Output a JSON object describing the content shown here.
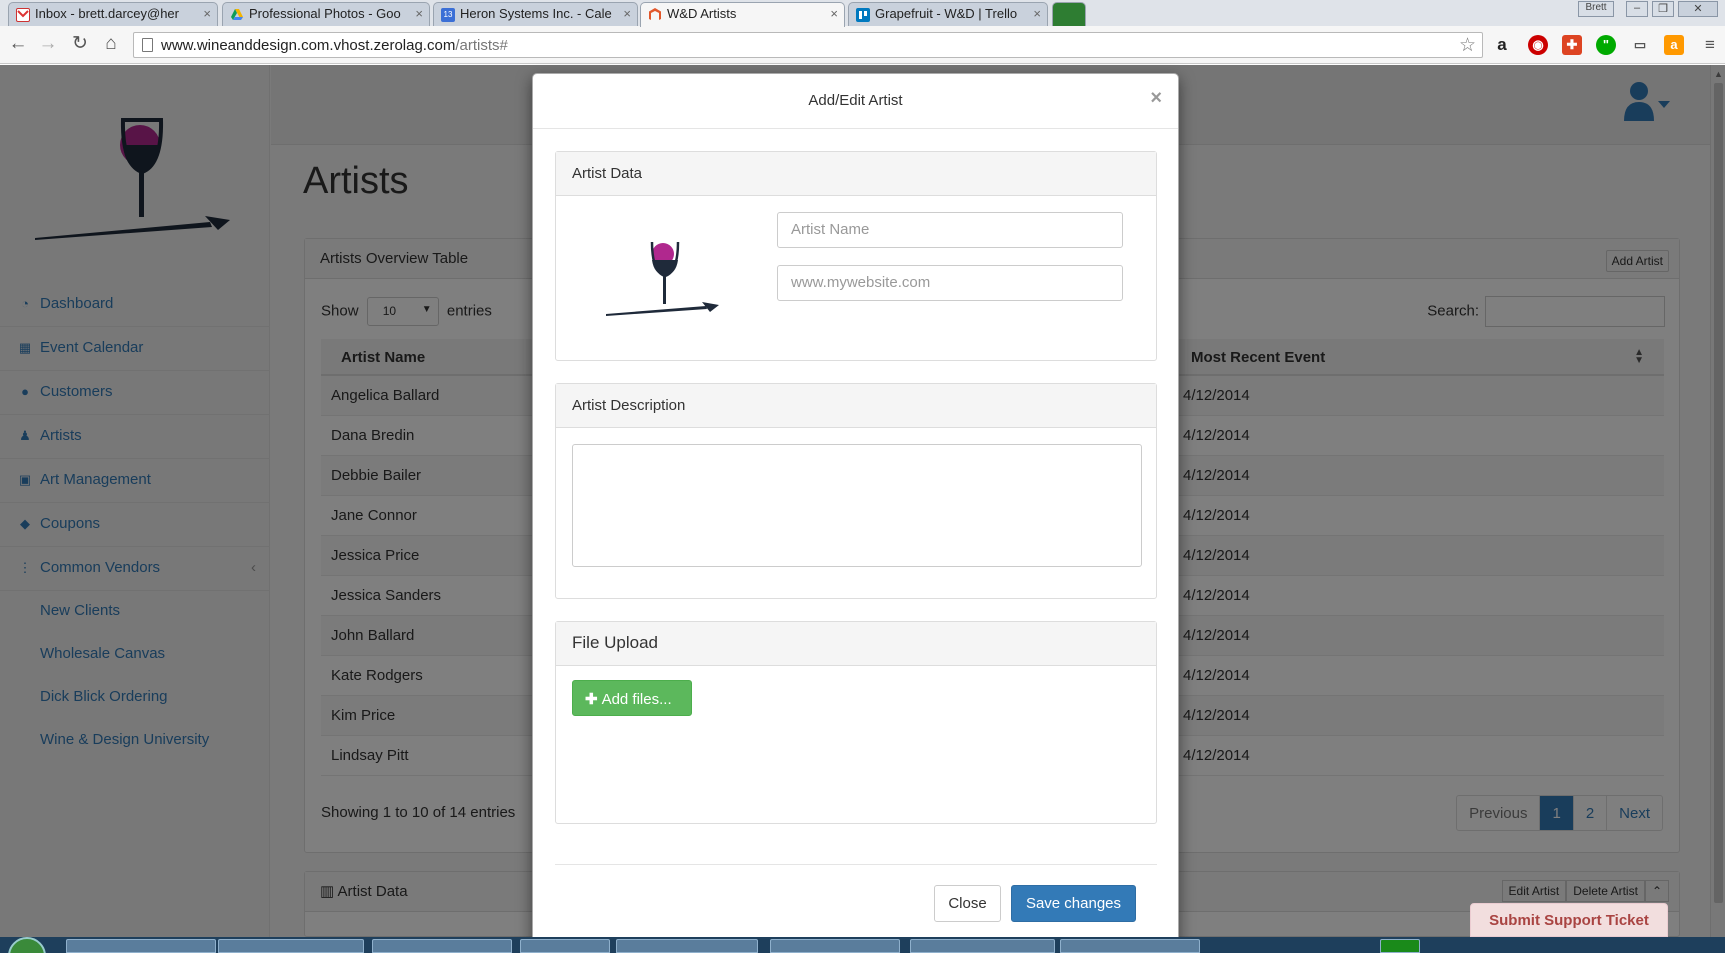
{
  "browser": {
    "tabs": [
      {
        "label": "Inbox - brett.darcey@her",
        "icon": "gmail-icon",
        "active": false
      },
      {
        "label": "Professional Photos - Goo",
        "icon": "google-drive-icon",
        "active": false
      },
      {
        "label": "Heron Systems Inc. - Cale",
        "icon": "calendar-icon",
        "active": false
      },
      {
        "label": "W&D Artists",
        "icon": "magento-icon",
        "active": true
      },
      {
        "label": "Grapefruit - W&D | Trello",
        "icon": "trello-icon",
        "active": false
      }
    ],
    "profile_name": "Brett",
    "url_host": "www.wineanddesign.com.vhost.zerolag.com",
    "url_path": "/artists#"
  },
  "sidebar": {
    "items": [
      {
        "label": "Dashboard",
        "icon": "dashboard-icon"
      },
      {
        "label": "Event Calendar",
        "icon": "calendar-icon"
      },
      {
        "label": "Customers",
        "icon": "users-icon"
      },
      {
        "label": "Artists",
        "icon": "person-icon"
      },
      {
        "label": "Art Management",
        "icon": "image-icon"
      },
      {
        "label": "Coupons",
        "icon": "tag-icon"
      },
      {
        "label": "Common Vendors",
        "icon": "vertical-dots-icon"
      }
    ],
    "subitems": [
      "New Clients",
      "Wholesale Canvas",
      "Dick Blick Ordering",
      "Wine & Design University"
    ]
  },
  "page": {
    "title": "Artists",
    "overview_panel_title": "Artists Overview Table",
    "add_artist_label": "Add Artist",
    "show_label": "Show",
    "entries_label": "entries",
    "entries_value": "10",
    "search_label": "Search:",
    "columns": [
      "Artist Name",
      "Most Recent Event"
    ],
    "rows": [
      {
        "name": "Angelica Ballard",
        "event": "4/12/2014"
      },
      {
        "name": "Dana Bredin",
        "event": "4/12/2014"
      },
      {
        "name": "Debbie Bailer",
        "event": "4/12/2014"
      },
      {
        "name": "Jane Connor",
        "event": "4/12/2014"
      },
      {
        "name": "Jessica Price",
        "event": "4/12/2014"
      },
      {
        "name": "Jessica Sanders",
        "event": "4/12/2014"
      },
      {
        "name": "John Ballard",
        "event": "4/12/2014"
      },
      {
        "name": "Kate Rodgers",
        "event": "4/12/2014"
      },
      {
        "name": "Kim Price",
        "event": "4/12/2014"
      },
      {
        "name": "Lindsay Pitt",
        "event": "4/12/2014"
      }
    ],
    "info": "Showing 1 to 10 of 14 entries",
    "pager": {
      "previous": "Previous",
      "pages": [
        "1",
        "2"
      ],
      "current": "1",
      "next": "Next"
    },
    "artist_data_panel_title": "Artist Data",
    "edit_artist_label": "Edit Artist",
    "delete_artist_label": "Delete Artist"
  },
  "modal": {
    "title": "Add/Edit Artist",
    "close_glyph": "×",
    "artist_data_title": "Artist Data",
    "name_placeholder": "Artist Name",
    "website_placeholder": "www.mywebsite.com",
    "description_title": "Artist Description",
    "upload_title": "File Upload",
    "add_files_label": "Add files...",
    "close_label": "Close",
    "save_label": "Save changes"
  },
  "support_ticket_label": "Submit Support Ticket",
  "colors": {
    "primary": "#337ab7",
    "success": "#5cb85c",
    "logo_magenta": "#b0288e",
    "logo_dark": "#1f2a3a",
    "ticket_bg": "#f2dede",
    "ticket_text": "#a94442"
  }
}
